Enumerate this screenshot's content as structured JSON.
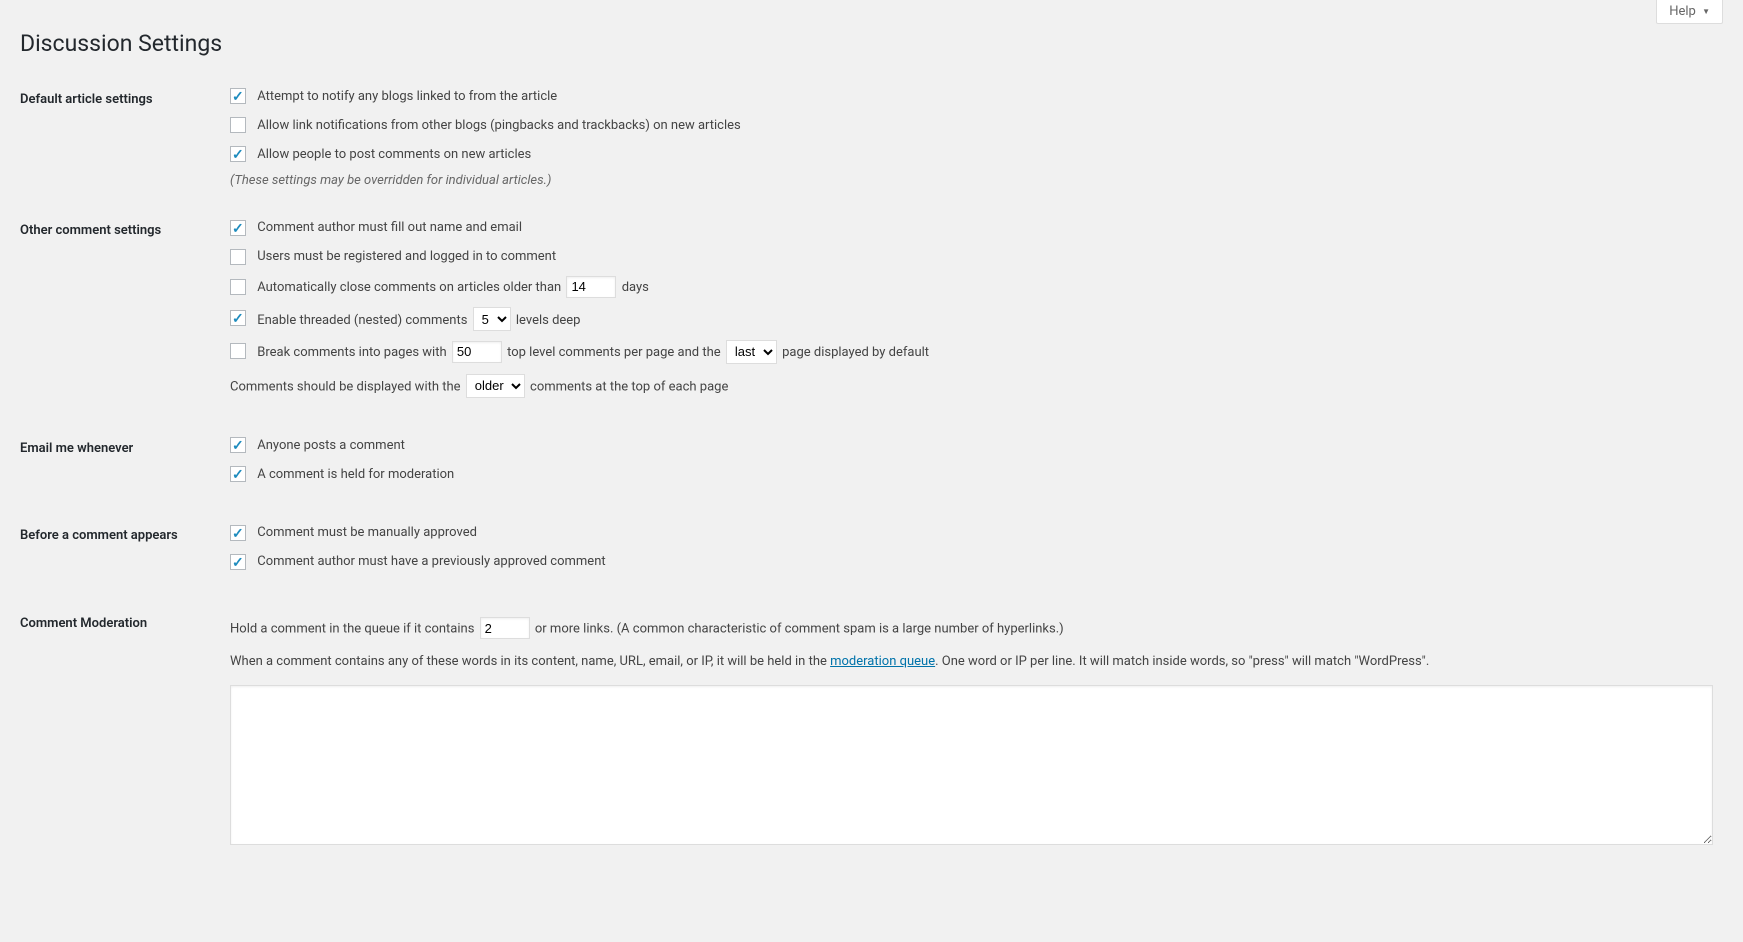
{
  "help_label": "Help",
  "page_title": "Discussion Settings",
  "sections": {
    "default_article": {
      "heading": "Default article settings",
      "pingback": {
        "checked": true,
        "label": "Attempt to notify any blogs linked to from the article"
      },
      "allow_ping": {
        "checked": false,
        "label": "Allow link notifications from other blogs (pingbacks and trackbacks) on new articles"
      },
      "allow_comments": {
        "checked": true,
        "label": "Allow people to post comments on new articles"
      },
      "note": "(These settings may be overridden for individual articles.)"
    },
    "other_comment": {
      "heading": "Other comment settings",
      "require_name": {
        "checked": true,
        "label": "Comment author must fill out name and email"
      },
      "require_reg": {
        "checked": false,
        "label": "Users must be registered and logged in to comment"
      },
      "auto_close": {
        "checked": false,
        "label_before": "Automatically close comments on articles older than",
        "value": "14",
        "label_after": "days"
      },
      "threaded": {
        "checked": true,
        "label_before": "Enable threaded (nested) comments",
        "value": "5",
        "label_after": "levels deep"
      },
      "paginate": {
        "checked": false,
        "label_before": "Break comments into pages with",
        "per_page": "50",
        "label_mid": "top level comments per page and the",
        "default_page": "last",
        "label_after": "page displayed by default"
      },
      "order": {
        "label_before": "Comments should be displayed with the",
        "value": "older",
        "label_after": "comments at the top of each page"
      }
    },
    "email_me": {
      "heading": "Email me whenever",
      "anyone_posts": {
        "checked": true,
        "label": "Anyone posts a comment"
      },
      "held_mod": {
        "checked": true,
        "label": "A comment is held for moderation"
      }
    },
    "before_appears": {
      "heading": "Before a comment appears",
      "manual_approve": {
        "checked": true,
        "label": "Comment must be manually approved"
      },
      "prev_approved": {
        "checked": true,
        "label": "Comment author must have a previously approved comment"
      }
    },
    "moderation": {
      "heading": "Comment Moderation",
      "max_links_before": "Hold a comment in the queue if it contains",
      "max_links_value": "2",
      "max_links_after": "or more links. (A common characteristic of comment spam is a large number of hyperlinks.)",
      "words_intro_before": "When a comment contains any of these words in its content, name, URL, email, or IP, it will be held in the ",
      "words_link": "moderation queue",
      "words_intro_after": ". One word or IP per line. It will match inside words, so \"press\" will match \"WordPress\".",
      "textarea_value": ""
    }
  }
}
